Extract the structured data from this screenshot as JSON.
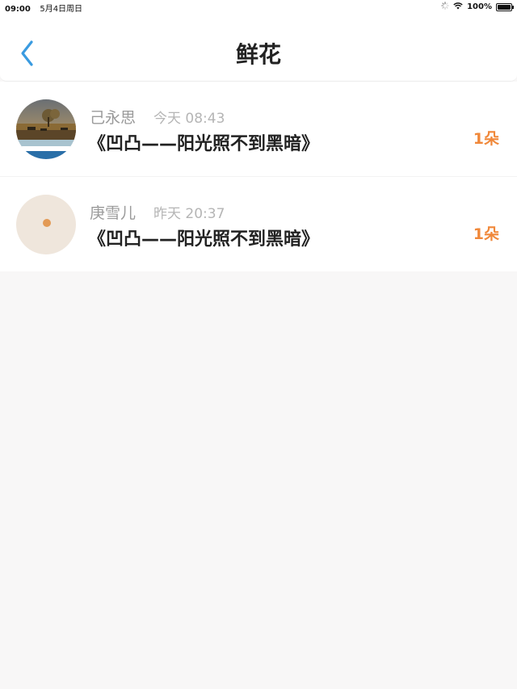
{
  "status_bar": {
    "time": "09:00",
    "date": "5月4日周日",
    "battery": "100%",
    "battery_level": 1.0
  },
  "header": {
    "title": "鲜花",
    "back_icon": "chevron-left-icon",
    "accent_color": "#3a9be0"
  },
  "flowers": [
    {
      "name": "己永思",
      "time": "今天 08:43",
      "subject": "《凹凸——阳光照不到黑暗》",
      "count": "1朵"
    },
    {
      "name": "庚雪儿",
      "time": "昨天 20:37",
      "subject": "《凹凸——阳光照不到黑暗》",
      "count": "1朵"
    }
  ],
  "colors": {
    "count": "#f0883a",
    "background": "#f8f7f7"
  }
}
